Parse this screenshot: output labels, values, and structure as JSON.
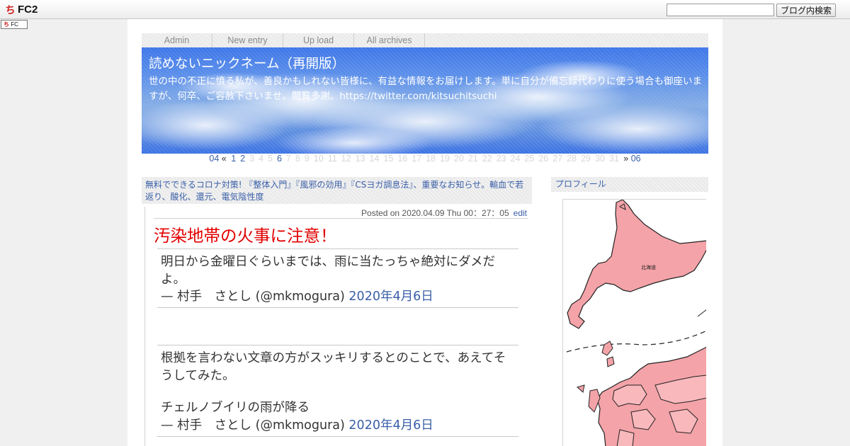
{
  "fc2bar": {
    "logo_text": "FC2",
    "search_placeholder": "",
    "search_button": "ブログ内検索",
    "badge_text": "FC"
  },
  "nav": [
    {
      "label": "Admin"
    },
    {
      "label": "New entry"
    },
    {
      "label": "Up load"
    },
    {
      "label": "All archives"
    }
  ],
  "header": {
    "title": "読めないニックネーム（再開版）",
    "description": "世の中の不正に憤る私が、善良かもしれない皆様に、有益な情報をお届けします。単に自分が備忘録代わりに使う場合も御座いますが、何卒、ご容赦下さいませ。閲覧多謝。https://twitter.com/kitsuchitsuchi"
  },
  "pager": {
    "prev_month": "04",
    "prev_arrow": "«",
    "days": [
      "1",
      "2",
      "3",
      "4",
      "5",
      "6",
      "7",
      "8",
      "9",
      "10",
      "11",
      "12",
      "13",
      "14",
      "15",
      "16",
      "17",
      "18",
      "19",
      "20",
      "21",
      "22",
      "23",
      "24",
      "25",
      "26",
      "27",
      "28",
      "29",
      "30",
      "31"
    ],
    "active_days": [
      "1",
      "2",
      "6"
    ],
    "next_arrow": "»",
    "next_month": "06"
  },
  "notice": "無料でできるコロナ対策! 『整体入門』『風邪の効用』『CSヨガ調息法』、重要なお知らせ。輸血で若返り、酸化、還元、電気陰性度",
  "entry": {
    "posted_label": "Posted on 2020.04.09 Thu 00：27：05",
    "edit_label": "edit",
    "title": "汚染地帯の火事に注意！",
    "quotes": [
      {
        "text": "明日から金曜日ぐらいまでは、雨に当たっちゃ絶対にダメだよ。",
        "author": "— 村手　さとし (@mkmogura)",
        "date": "2020年4月6日"
      },
      {
        "text": "根拠を言わない文章の方がスッキリするとのことで、あえてそうしてみた。",
        "text2": "チェルノブイリの雨が降る",
        "author": "— 村手　さとし (@mkmogura)",
        "date": "2020年4月6日"
      }
    ]
  },
  "sidebar": {
    "title": "プロフィール",
    "map_label": "北海道"
  },
  "colors": {
    "link": "#3a5fa8",
    "title_red": "#e20000",
    "map_fill": "#f4a3a8"
  }
}
